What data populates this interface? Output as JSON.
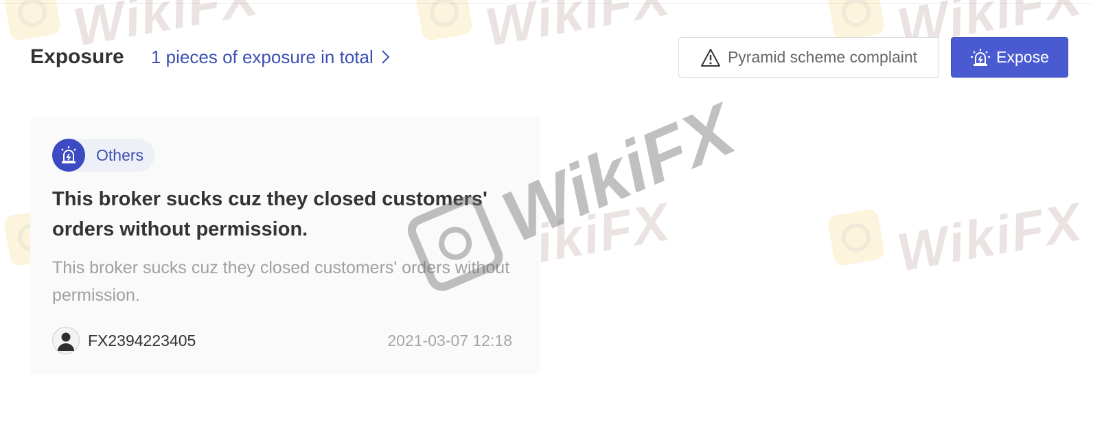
{
  "header": {
    "title": "Exposure",
    "total_link": "1 pieces of exposure in total",
    "complaint_button": "Pyramid scheme complaint",
    "expose_button": "Expose"
  },
  "card": {
    "category": "Others",
    "title": "This broker sucks cuz they closed customers' orders without permission.",
    "body": "This broker sucks cuz they closed customers' orders without permission.",
    "username": "FX2394223405",
    "timestamp": "2021-03-07 12:18"
  },
  "watermark": {
    "brand": "WikiFX"
  },
  "colors": {
    "accent": "#4a5bd1",
    "link": "#3b4fb3",
    "tag_icon_bg": "#3c4bc2",
    "card_bg": "#fafafa",
    "muted_text": "#a0a0a0"
  },
  "icons": {
    "total_link": "chevron-right-icon",
    "complaint_button": "warning-triangle-icon",
    "expose_button": "alarm-siren-icon",
    "tag": "alarm-siren-icon",
    "avatar": "user-avatar-icon"
  }
}
